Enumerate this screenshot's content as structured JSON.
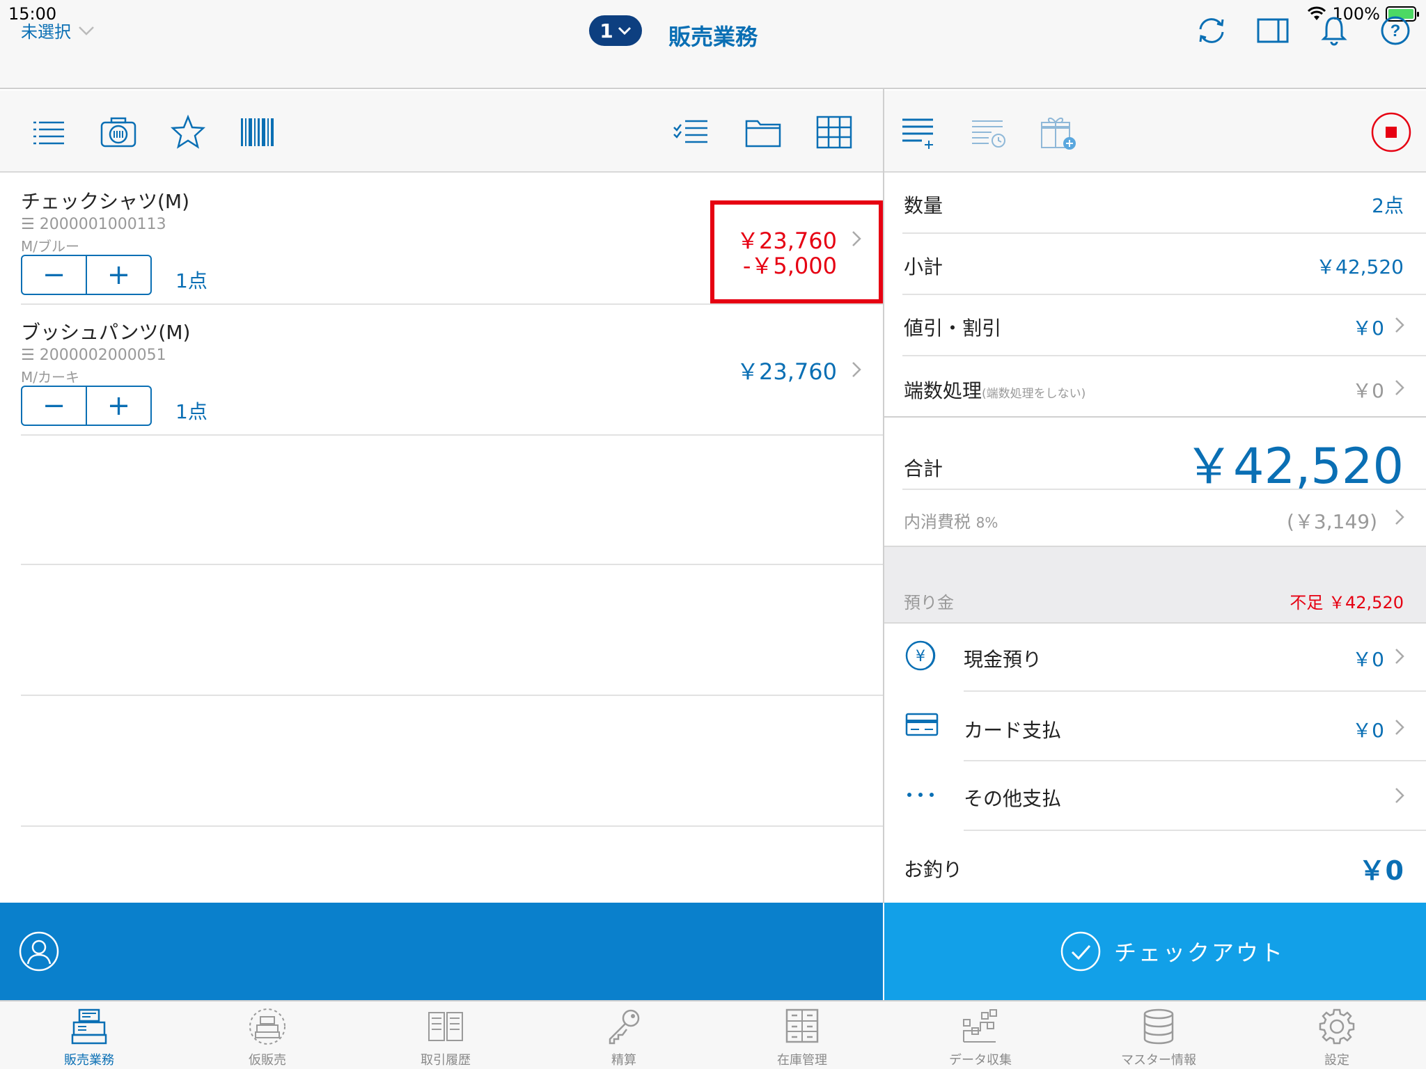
{
  "status_bar": {
    "time": "15:00",
    "battery_pct": "100%"
  },
  "nav": {
    "unselected_label": "未選択",
    "badge_number": "1",
    "title": "販売業務"
  },
  "items": [
    {
      "name": "チェックシャツ(M)",
      "code": "☰ 2000001000113",
      "variant": "M/ブルー",
      "minus": "−",
      "plus": "+",
      "qty": "1点",
      "price": "￥23,760",
      "discount": "-￥5,000"
    },
    {
      "name": "ブッシュパンツ(M)",
      "code": "☰ 2000002000051",
      "variant": "M/カーキ",
      "minus": "−",
      "plus": "+",
      "qty": "1点",
      "price": "￥23,760"
    }
  ],
  "summary": {
    "quantity_label": "数量",
    "quantity_value": "2点",
    "subtotal_label": "小計",
    "subtotal_value": "￥42,520",
    "discount_label": "値引・割引",
    "discount_value": "￥0",
    "rounding_label": "端数処理",
    "rounding_note": "(端数処理をしない)",
    "rounding_value": "￥0",
    "total_label": "合計",
    "total_value": "￥42,520",
    "tax_label": "内消費税",
    "tax_rate": "8%",
    "tax_value": "(￥3,149)"
  },
  "payment": {
    "deposit_label": "預り金",
    "shortage_label": "不足",
    "shortage_value": "￥42,520",
    "cash_label": "現金預り",
    "cash_value": "￥0",
    "card_label": "カード支払",
    "card_value": "￥0",
    "other_label": "その他支払",
    "change_label": "お釣り",
    "change_value": "￥0"
  },
  "checkout": {
    "label": "チェックアウト"
  },
  "tabs": [
    {
      "label": "販売業務",
      "icon": "register-icon",
      "active": true
    },
    {
      "label": "仮販売",
      "icon": "temp-register-icon",
      "active": false
    },
    {
      "label": "取引履歴",
      "icon": "book-icon",
      "active": false
    },
    {
      "label": "精算",
      "icon": "key-icon",
      "active": false
    },
    {
      "label": "在庫管理",
      "icon": "drawers-icon",
      "active": false
    },
    {
      "label": "データ収集",
      "icon": "data-collect-icon",
      "active": false
    },
    {
      "label": "マスター情報",
      "icon": "database-icon",
      "active": false
    },
    {
      "label": "設定",
      "icon": "gear-icon",
      "active": false
    }
  ],
  "colors": {
    "accent": "#0a6fb4",
    "alert": "#e60012",
    "bottom_left": "#0a80cc",
    "bottom_right": "#12a0e8"
  }
}
